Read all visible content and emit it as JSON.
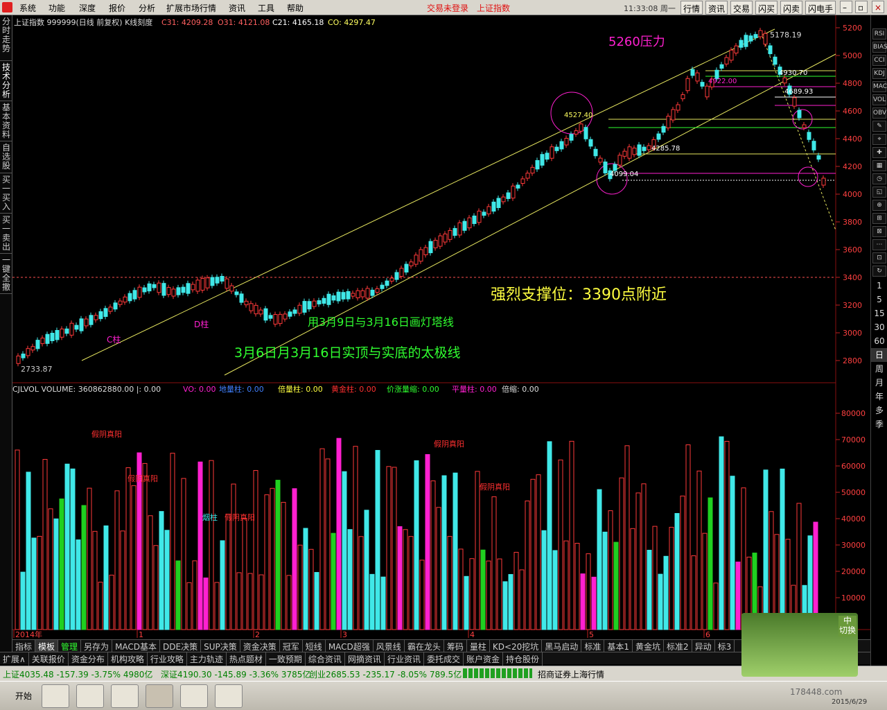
{
  "menu": {
    "items": [
      "系统",
      "功能",
      "深度",
      "报价",
      "分析",
      "扩展市场行情",
      "资讯",
      "工具",
      "帮助"
    ],
    "status_red": [
      "交易未登录",
      "上证指数"
    ],
    "time": "11:33:08 周一",
    "buttons": [
      "行情",
      "资讯",
      "交易",
      "闪买",
      "闪卖",
      "闪电手"
    ]
  },
  "leftnav": [
    "分时走势",
    "技术分析",
    "基本资料",
    "自选股",
    "买一买入",
    "买一卖出",
    "一键全撤"
  ],
  "header": {
    "title": "上证指数 999999(日线 前复权) K线刻度",
    "c31": "C31: 4209.28",
    "o31": "O31: 4121.08",
    "c21": "C21: 4165.18",
    "co": "CO: 4297.47"
  },
  "price_axis": [
    "5200",
    "5000",
    "4800",
    "4600",
    "4400",
    "4200",
    "4000",
    "3800",
    "3600",
    "3400",
    "3200",
    "3000",
    "2800"
  ],
  "volume_axis": [
    "80000",
    "70000",
    "60000",
    "50000",
    "40000",
    "30000",
    "20000",
    "10000"
  ],
  "volume_header": {
    "main": "CJLVOL VOLUME: 360862880.00 |: 0.00",
    "vo": "VO: 0.00",
    "dl": "地量柱: 0.00",
    "bl": "倍量柱: 0.00",
    "hj": "黄金柱: 0.00",
    "jz": "价涨量缩: 0.00",
    "pl": "平量柱: 0.00",
    "bs": "倍缩: 0.00"
  },
  "annotations": {
    "pressure": "5260压力",
    "support": "强烈支撑位：3390点附近",
    "lighthouse": "用3月9日与3月16日画灯塔线",
    "taiji": "3月6日月3月16日实顶与实底的太极线",
    "c_col": "C柱",
    "d_col": "D柱",
    "low": "2733.87",
    "high": "5178.19",
    "l4527": "4527.40",
    "l4285": "4285.78",
    "l4099": "4099.04",
    "l4930": "4930.70",
    "l4689": "4689.93",
    "l4922": "4922.00",
    "fake": "假阴真阳",
    "yan": "烟柱"
  },
  "time_axis": [
    "2014年",
    "1",
    "2",
    "3",
    "4",
    "5",
    "6"
  ],
  "bottom_tabs1": [
    "指标",
    "模板",
    "管理",
    "另存为",
    "MACD基本",
    "DDE决策",
    "SUP决策",
    "资金决策",
    "冠军",
    "短线",
    "MACD超强",
    "风景线",
    "霸在龙头",
    "筹码",
    "量柱",
    "KD<20挖坑",
    "黑马启动",
    "标准",
    "基本1",
    "黄金坑",
    "标准2",
    "异动",
    "标3"
  ],
  "bottom_tabs2": [
    "扩展∧",
    "关联报价",
    "资金分布",
    "机构攻略",
    "行业攻略",
    "主力轨迹",
    "热点题材",
    "一致预期",
    "综合资讯",
    "网摘资讯",
    "行业资讯",
    "委托成交",
    "账户资金",
    "持仓股份"
  ],
  "status": {
    "sh": "上证4035.48 -157.39 -3.75% 4980亿",
    "sz": "深证4190.30 -145.89 -3.36% 3785亿",
    "cy": "创业2685.53 -235.17 -8.05% 789.5亿",
    "broker": "招商证券上海行情"
  },
  "right_labels": [
    "1",
    "5",
    "15",
    "30",
    "60",
    "日",
    "周",
    "月",
    "年",
    "多",
    "季"
  ],
  "right_icons": [
    "RSI",
    "BIAS",
    "CCI",
    "KDJ",
    "MACD",
    "VOL",
    "OBV"
  ],
  "taskbar": {
    "start": "开始",
    "date": "2015/6/29",
    "site": "178448.com"
  },
  "overlay": {
    "badge": "中 切换"
  },
  "colors": {
    "up": "#ff3a3a",
    "down": "#40e8e8",
    "magenta": "#ff20d0",
    "green": "#20d020",
    "yellow": "#ffff40"
  }
}
